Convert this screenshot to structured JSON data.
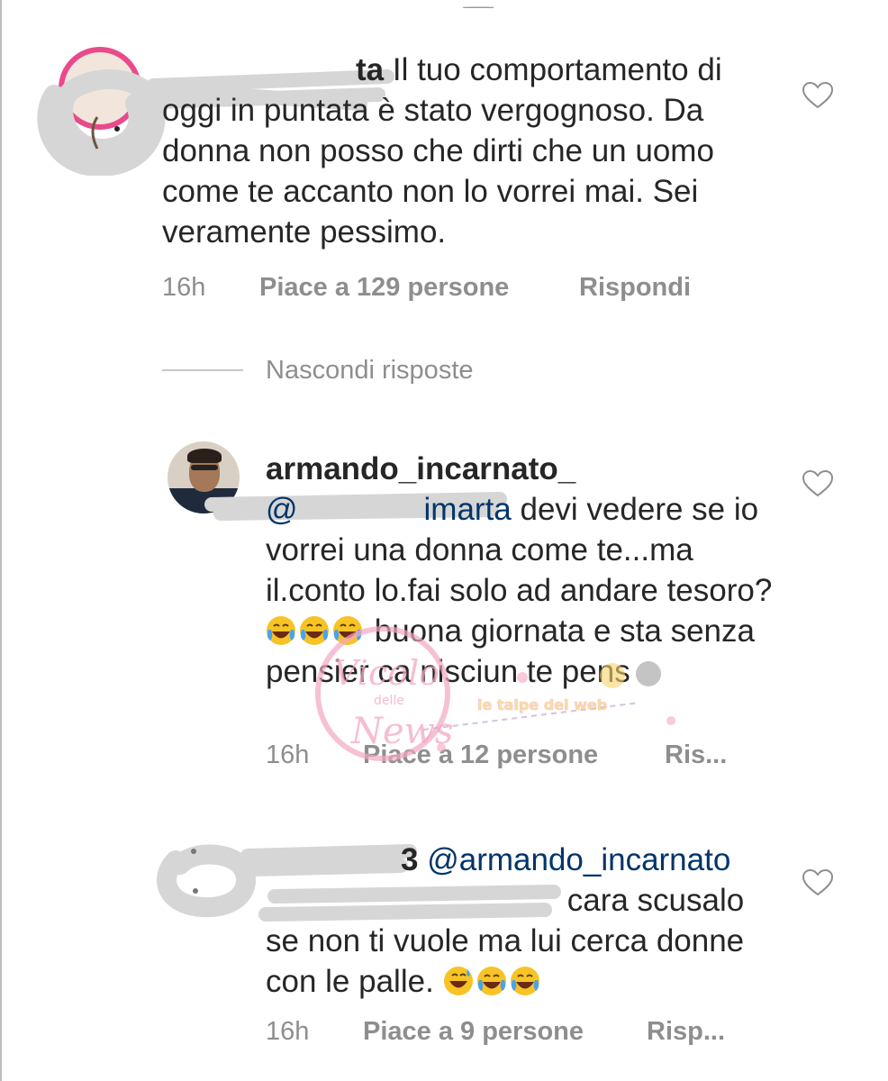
{
  "comments": [
    {
      "username": "ta",
      "text": " Il tuo comportamento di oggi in puntata è stato vergognoso. Da donna non posso che dirti che un uomo come te accanto non lo vorrei mai. Sei veramente pessimo.",
      "time": "16h",
      "likes": "Piace a 129 persone",
      "reply": "Rispondi"
    }
  ],
  "hide_replies": "Nascondi risposte",
  "replies": [
    {
      "username": "armando_incarnato_",
      "mention": "@",
      "mention_tail": "imarta",
      "text_1": " devi vedere se io vorrei una donna come te...ma il.conto lo.fai solo ad andare tesoro? ",
      "emoji_run": [
        "face-with-tears-of-joy",
        "face-with-tears-of-joy",
        "face-with-tears-of-joy"
      ],
      "text_2": " buona giornata e sta senza pensier ca nisciun te pens",
      "time": "16h",
      "likes": "Piace a 12 persone",
      "reply": "Ris..."
    },
    {
      "username": "3",
      "mention": " @armando_incarnato",
      "text_1": " cara scusalo se non ti vuole ma lui cerca donne con le palle. ",
      "emoji_run": [
        "grinning-face-with-sweat",
        "face-with-tears-of-joy",
        "face-with-tears-of-joy"
      ],
      "time": "16h",
      "likes": "Piace a 9 persone",
      "reply": "Risp..."
    }
  ],
  "watermark": {
    "brand": "Vicolo delle News",
    "tagline": "le talpe del web"
  },
  "colors": {
    "text": "#262626",
    "meta": "#8e8e8e",
    "mention": "#003569",
    "divider": "#c7c7c7",
    "scribble": "#d6d6d6",
    "watermark_pink": "#f4a7c3"
  }
}
